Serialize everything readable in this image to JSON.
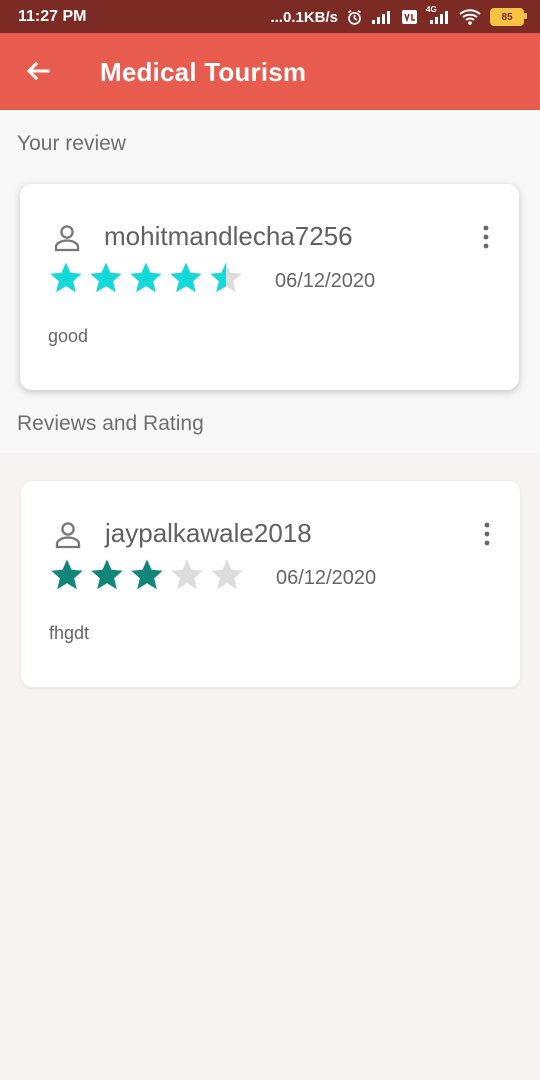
{
  "status_bar": {
    "time": "11:27 PM",
    "network_speed": "...0.1KB/s",
    "signal_label": "4G",
    "battery": "85",
    "icons": [
      "alarm-icon",
      "signal-icon",
      "volte-icon",
      "signal-4g-icon",
      "wifi-icon",
      "battery-icon"
    ]
  },
  "app_bar": {
    "title": "Medical Tourism",
    "back_icon": "arrow-left-icon"
  },
  "your_review": {
    "section_label": "Your review",
    "username": "mohitmandlecha7256",
    "rating": 4.5,
    "max_rating": 5,
    "date": "06/12/2020",
    "comment": "good",
    "star_color": "#16d8d8"
  },
  "reviews": {
    "section_label": "Reviews and Rating",
    "items": [
      {
        "username": "jaypalkawale2018",
        "rating": 3,
        "max_rating": 5,
        "date": "06/12/2020",
        "comment": "fhgdt",
        "star_color": "#12857b"
      }
    ]
  },
  "colors": {
    "app_bar": "#e85c4f",
    "status_bar": "#7c2a24",
    "empty_star": "#dddddd"
  }
}
